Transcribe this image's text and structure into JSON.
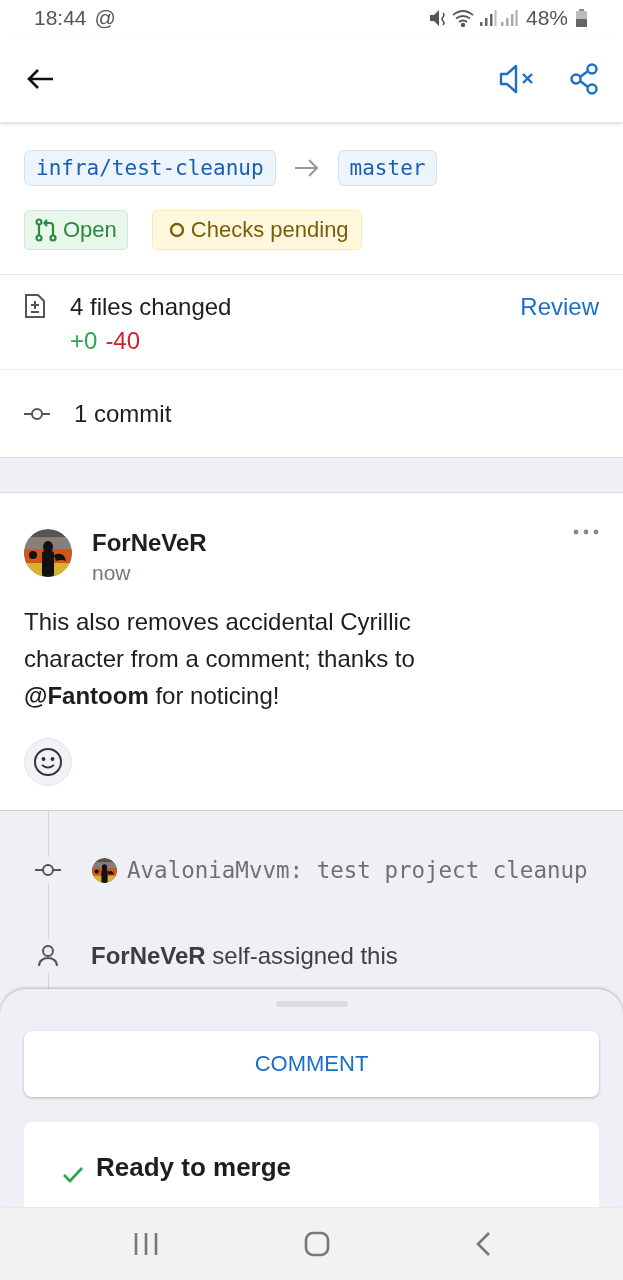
{
  "status_bar": {
    "time": "18:44",
    "notification": "@",
    "battery": "48%"
  },
  "branches": {
    "head": "infra/test-cleanup",
    "base": "master"
  },
  "badges": [
    {
      "kind": "state",
      "label": "Open"
    },
    {
      "kind": "checks",
      "label": "Checks pending"
    }
  ],
  "files": {
    "label": "4 files changed",
    "additions": "+0",
    "deletions": "-40",
    "action": "Review"
  },
  "commits": {
    "label": "1 commit"
  },
  "comment": {
    "author": "ForNeVeR",
    "time": "now",
    "body": "This also removes accidental Cyrillic character from a comment; thanks to **@Fantoom** for noticing!"
  },
  "timeline": [
    {
      "kind": "commit",
      "text": "AvaloniaMvvm: test project cleanup"
    },
    {
      "kind": "assigned",
      "text": "**ForNeVeR** self-assigned this"
    }
  ],
  "sheet": {
    "button": "COMMENT",
    "merge_status": "Ready to merge"
  }
}
